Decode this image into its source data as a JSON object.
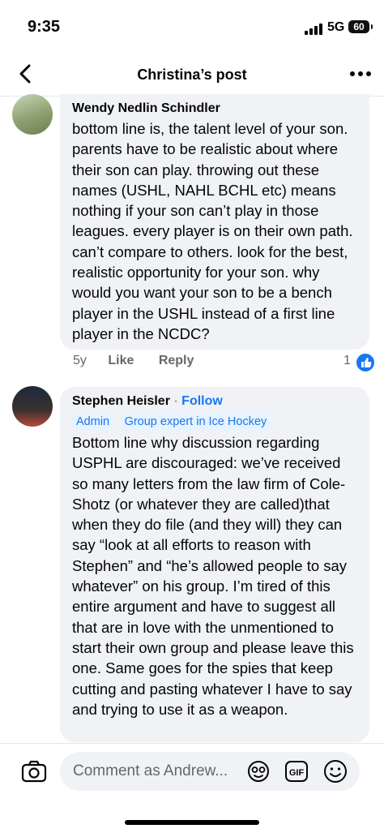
{
  "status": {
    "time": "9:35",
    "network": "5G",
    "battery": "60"
  },
  "nav": {
    "title": "Christina’s post"
  },
  "comments": [
    {
      "author": "Wendy Nedlin Schindler",
      "text": "bottom line is, the talent level of your son. parents have to be realistic about where their son can play. throwing out these names (USHL, NAHL BCHL etc) means nothing if your son can’t play in those leagues. every player is on their own path. can’t compare to others. look for the best, realistic opportunity for your son. why would you want your son to be a bench player in the USHL instead of a first line player in the NCDC?",
      "age": "5y",
      "like_label": "Like",
      "reply_label": "Reply",
      "reaction_count": "1"
    },
    {
      "author": "Stephen Heisler",
      "separator": "·",
      "follow_label": "Follow",
      "badges": [
        "Admin",
        "Group expert in Ice Hockey"
      ],
      "text": "Bottom line why discussion regarding USPHL are discouraged: we’ve received so many letters from the law firm of Cole-Shotz (or whatever they are called)that when they do file (and they will) they can say “look at all efforts to reason with Stephen” and “he’s allowed people to say whatever” on his group. I’m tired of this entire argument and have to suggest all that are in love with the unmentioned to start their own group and please leave this one. Same goes for the spies that keep cutting and pasting whatever I have to say and trying to use it as a weapon."
    }
  ],
  "composer": {
    "placeholder": "Comment as Andrew..."
  },
  "icons": [
    "back-icon",
    "more-icon",
    "camera-icon",
    "avatar-sticker-icon",
    "gif-icon",
    "emoji-icon",
    "like-reaction-icon"
  ],
  "colors": {
    "accent": "#1877f2",
    "bubble": "#f0f2f5",
    "muted": "#65676b"
  }
}
